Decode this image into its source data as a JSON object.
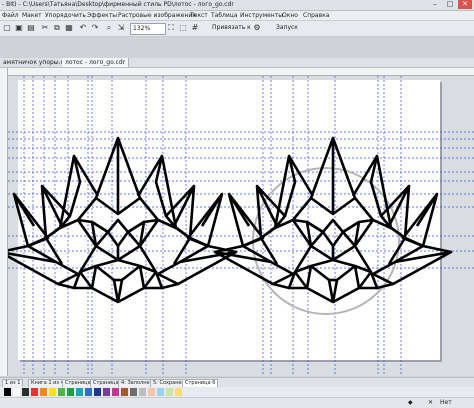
{
  "window": {
    "title": "- BIt) - C:\\Users\\Татьяна\\Desktop\\фирменный стиль PD\\лотос - лого_go.cdr",
    "controls": [
      "–",
      "□",
      "✕"
    ]
  },
  "menu": [
    "Файл",
    "Макет",
    "Упорядочить",
    "Эффекты",
    "Растровые изображения",
    "Текст",
    "Таблица",
    "Инструменты",
    "Окно",
    "Справка"
  ],
  "toolbar": {
    "zoom": "132%",
    "snap_label": "Привязать к",
    "launch_label": "Запуск"
  },
  "tabs": [
    {
      "label": "амятничок упоры.cdr",
      "active": false
    },
    {
      "label": "лотос - лого_go.cdr",
      "active": true
    }
  ],
  "bottom": {
    "page_counter": "1 из 1",
    "page_tabs": [
      "Книга 1 из 4",
      "Страница 2",
      "Страница 3",
      "4: Заполнение",
      "5: Сохранение",
      "6: Сокращение",
      "Страница 6"
    ]
  },
  "palette": [
    "#000000",
    "#ffffff",
    "#2d2d2d",
    "#e8312a",
    "#f08a1c",
    "#f6e21a",
    "#4fb647",
    "#1d9e4a",
    "#1aa6b7",
    "#2f6fc4",
    "#1b3a8c",
    "#7b3aa0",
    "#c2378e",
    "#a05a2c",
    "#6d6d6d",
    "#bdbdbd",
    "#f5c6a5",
    "#9dd3f2",
    "#c8e6a0",
    "#ffd97a"
  ],
  "status": {
    "fill_label": "Нет",
    "outline_label": "Нет"
  },
  "colors": {
    "guide": "#3a4fd8",
    "drawing": "#000000",
    "circle": "#b5b5b5"
  }
}
